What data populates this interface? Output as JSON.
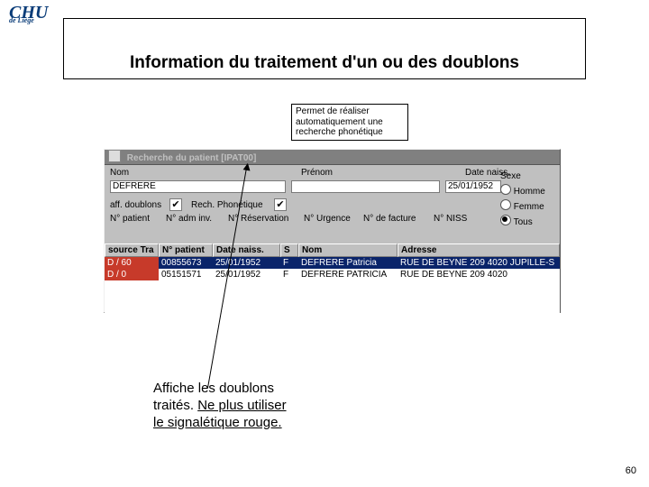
{
  "logo": {
    "main": "CHU",
    "sub": "de Liège"
  },
  "title": "Information du traitement d'un ou des doublons",
  "annotation_top": "Permet de réaliser automatiquement une recherche phonétique",
  "window": {
    "title": "Recherche du patient  [IPAT00]",
    "labels": {
      "nom": "Nom",
      "prenom": "Prénom",
      "datenaiss": "Date naiss.",
      "sexe": "Sexe",
      "aff": "aff. doublons",
      "phon": "Rech. Phonétique",
      "npatient": "N° patient",
      "nadmin": "N° adm inv.",
      "nresa": "N° Réservation",
      "nurg": "N° Urgence",
      "nfact": "N° de facture",
      "nniss": "N° NISS"
    },
    "fields": {
      "nom": "DEFRERE",
      "prenom": "",
      "date": "25/01/1952"
    },
    "checks": {
      "aff": "✔",
      "phon": "✔"
    },
    "sexe": {
      "h": "Homme",
      "f": "Femme",
      "t": "Tous",
      "selected": "t"
    },
    "headers": {
      "c1": "source Tra",
      "c2": "N° patient",
      "c3": "Date naiss.",
      "c4": "S",
      "c5": "Nom",
      "c6": "Adresse"
    },
    "rows": [
      {
        "src": "D / 60",
        "np": "00855673",
        "dn": "25/01/1952",
        "s": "F",
        "nom": "DEFRERE Patricia",
        "adr": "RUE DE BEYNE 209 4020 JUPILLE-S",
        "sel": true
      },
      {
        "src": "D / 0",
        "np": "05151571",
        "dn": "25/01/1952",
        "s": "F",
        "nom": "DEFRERE PATRICIA",
        "adr": "RUE DE BEYNE 209  4020",
        "sel": false
      }
    ]
  },
  "caption": {
    "line1": "Affiche les doublons",
    "line2": "traités. ",
    "u1": "Ne plus utiliser",
    "u2": "le signalétique rouge."
  },
  "page": "60"
}
